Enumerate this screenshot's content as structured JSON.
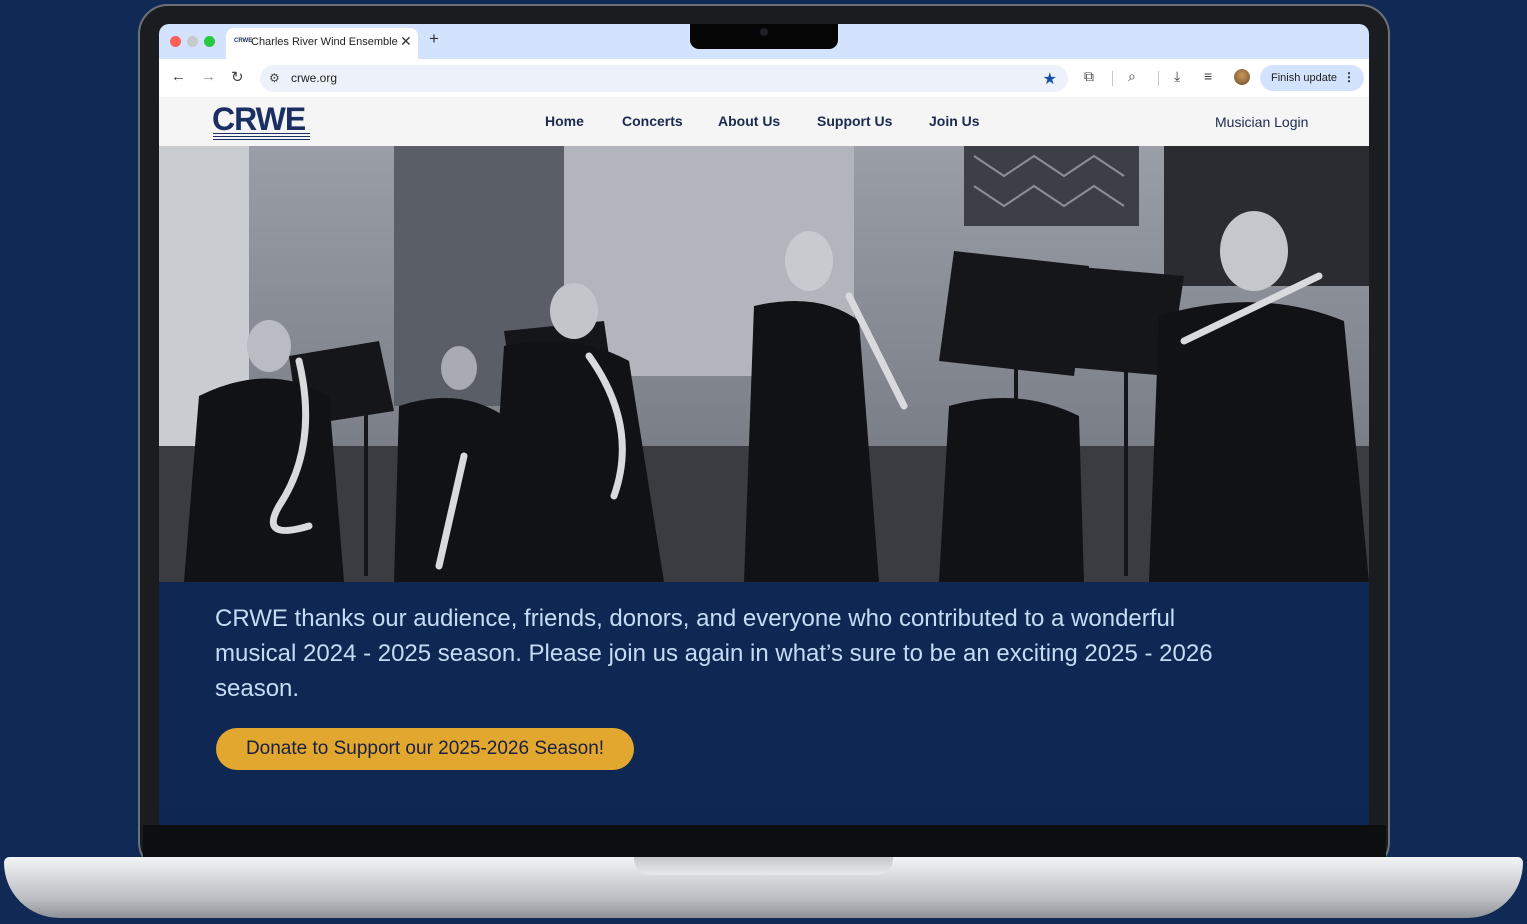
{
  "browser": {
    "tab_title": "Charles River Wind Ensemble",
    "tab_favicon": "CRWE",
    "new_tab_icon": "plus-icon",
    "url": "crwe.org",
    "finish_update_label": "Finish update"
  },
  "site": {
    "logo": "CRWE",
    "nav": {
      "home": "Home",
      "concerts": "Concerts",
      "about": "About Us",
      "support": "Support Us",
      "join": "Join Us"
    },
    "login": "Musician Login"
  },
  "banner": {
    "message": "CRWE thanks our audience, friends, donors, and everyone who contributed to a wonderful musical 2024 - 2025 season. Please join us again in what’s sure to be an exciting 2025 - 2026 season.",
    "cta": "Donate to Support our 2025-2026 Season!"
  },
  "colors": {
    "page_background": "#102a55",
    "banner_background": "#0f2853",
    "banner_text": "#c6dcf5",
    "cta_background": "#e2a72f",
    "logo_color": "#1b2f63"
  }
}
